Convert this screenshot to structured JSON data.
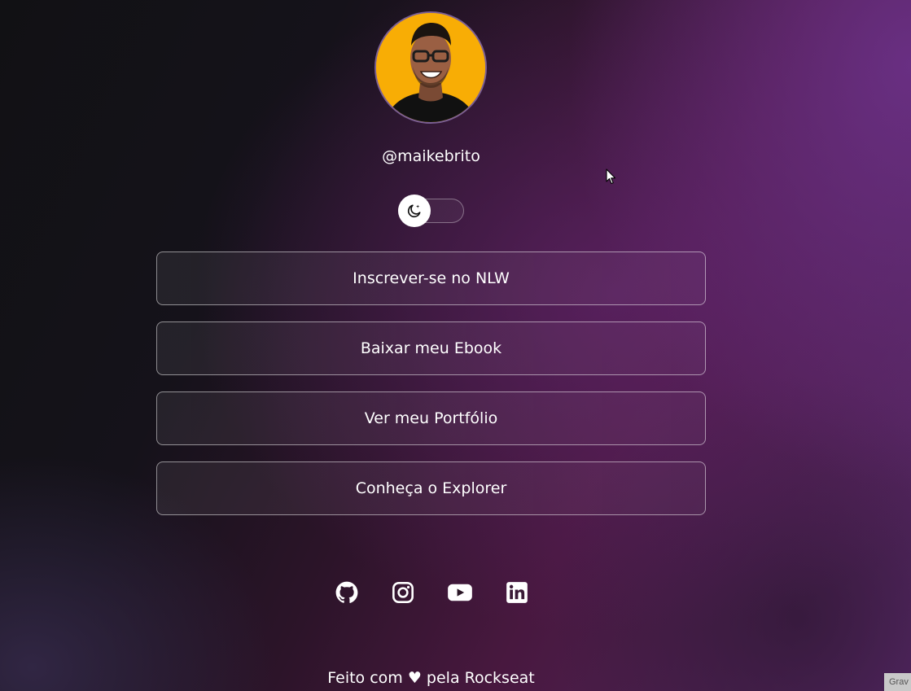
{
  "profile": {
    "username": "@maikebrito",
    "avatar_icon": "profile-photo",
    "avatar_bg": "#f8ad05"
  },
  "theme_toggle": {
    "icon": "moon-icon",
    "state": "dark"
  },
  "links": [
    {
      "label": "Inscrever-se no NLW"
    },
    {
      "label": "Baixar meu Ebook"
    },
    {
      "label": "Ver meu Portfólio"
    },
    {
      "label": "Conheça o Explorer"
    }
  ],
  "social": [
    {
      "icon": "github-icon"
    },
    {
      "icon": "instagram-icon"
    },
    {
      "icon": "youtube-icon"
    },
    {
      "icon": "linkedin-icon"
    }
  ],
  "footer": {
    "text": "Feito com ♥ pela Rockseat"
  },
  "corner_badge": {
    "text": "Grav"
  },
  "colors": {
    "accent_purple": "#5a2a6c",
    "text": "#ffffff"
  }
}
